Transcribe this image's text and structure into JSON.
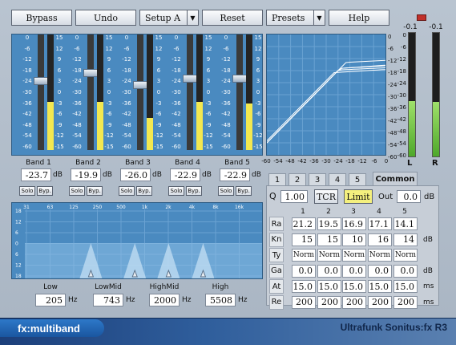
{
  "toolbar": {
    "bypass": "Bypass",
    "undo": "Undo",
    "setup": "Setup A",
    "reset": "Reset",
    "presets": "Presets",
    "help": "Help"
  },
  "band_scale": [
    "0",
    "-6",
    "-12",
    "-18",
    "-24",
    "-30",
    "-36",
    "-42",
    "-48",
    "-54",
    "-60"
  ],
  "meter_scale": [
    "15",
    "12",
    "9",
    "6",
    "3",
    "0",
    "-3",
    "-6",
    "-9",
    "-12",
    "-15"
  ],
  "bands": [
    {
      "name": "Band 1",
      "value": "-23.7",
      "level": 0.42,
      "slider": 0.4
    },
    {
      "name": "Band 2",
      "value": "-19.9",
      "level": 0.42,
      "slider": 0.33
    },
    {
      "name": "Band 3",
      "value": "-26.0",
      "level": 0.28,
      "slider": 0.44
    },
    {
      "name": "Band 4",
      "value": "-22.9",
      "level": 0.42,
      "slider": 0.38
    },
    {
      "name": "Band 5",
      "value": "-22.9",
      "level": 0.4,
      "slider": 0.38
    }
  ],
  "units": {
    "db": "dB",
    "hz": "Hz",
    "ms": "ms"
  },
  "solo": "Solo",
  "byp": "Byp.",
  "curve_xaxis": [
    "-60",
    "-54",
    "-48",
    "-42",
    "-36",
    "-30",
    "-24",
    "-18",
    "-12",
    "-6",
    "0"
  ],
  "curve_yaxis": [
    "0",
    "-6",
    "-12",
    "-18",
    "-24",
    "-30",
    "-36",
    "-42",
    "-48",
    "-54",
    "-60"
  ],
  "output_meter": {
    "left_peak": "-0.1",
    "right_peak": "-0.1",
    "left_label": "L",
    "right_label": "R",
    "left_level": 0.45,
    "right_level": 0.44,
    "scale": [
      "0",
      "-6",
      "-12",
      "-18",
      "-24",
      "-30",
      "-36",
      "-42",
      "-48",
      "-54",
      "-60"
    ]
  },
  "tabs": [
    "1",
    "2",
    "3",
    "4",
    "5",
    "Common"
  ],
  "common": {
    "q_label": "Q",
    "q_value": "1.00",
    "tcr": "TCR",
    "limit": "Limit",
    "out_label": "Out",
    "out_value": "0.0",
    "col_headers": [
      "1",
      "2",
      "3",
      "4",
      "5"
    ]
  },
  "rows": [
    {
      "label": "Ra",
      "values": [
        "21.2",
        "19.5",
        "16.9",
        "17.1",
        "14.1"
      ],
      "unit": ""
    },
    {
      "label": "Kn",
      "values": [
        "15",
        "15",
        "10",
        "16",
        "14"
      ],
      "unit": "dB"
    },
    {
      "label": "Ty",
      "values": [
        "Norm",
        "Norm",
        "Norm",
        "Norm",
        "Norm"
      ],
      "unit": ""
    },
    {
      "label": "Ga",
      "values": [
        "0.0",
        "0.0",
        "0.0",
        "0.0",
        "0.0"
      ],
      "unit": "dB"
    },
    {
      "label": "At",
      "values": [
        "15.0",
        "15.0",
        "15.0",
        "15.0",
        "15.0"
      ],
      "unit": "ms"
    },
    {
      "label": "Re",
      "values": [
        "200",
        "200",
        "200",
        "200",
        "200"
      ],
      "unit": "ms"
    }
  ],
  "freq_scale": [
    "31",
    "63",
    "125",
    "250",
    "500",
    "1k",
    "2k",
    "4k",
    "8k",
    "16k"
  ],
  "db_scale": [
    "18",
    "12",
    "6",
    "0",
    "6",
    "12",
    "18"
  ],
  "crossovers": [
    {
      "name": "Low",
      "value": "205"
    },
    {
      "name": "LowMid",
      "value": "743"
    },
    {
      "name": "HighMid",
      "value": "2000"
    },
    {
      "name": "High",
      "value": "5508"
    }
  ],
  "footer": {
    "left": "fx:multiband",
    "right": "Ultrafunk Sonitus:fx R3"
  }
}
